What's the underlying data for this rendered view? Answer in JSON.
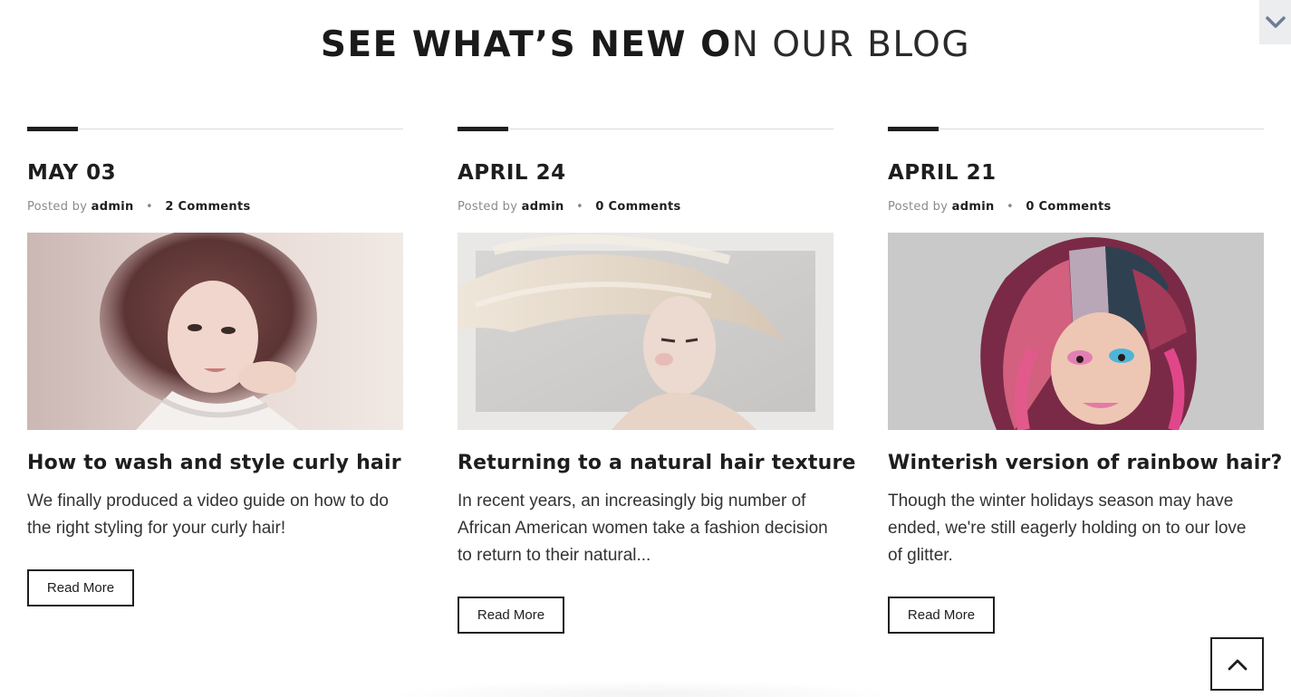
{
  "header": {
    "title_bold": "SEE WHAT’S NEW O",
    "title_light": "N OUR BLOG"
  },
  "posts": [
    {
      "date": "MAY 03",
      "posted_by_label": "Posted by",
      "author": "admin",
      "comments": "2 Comments",
      "title": "How to wash and style curly hair",
      "excerpt": "We finally produced a video guide on how to do the right styling for your curly hair!",
      "read_more": "Read More",
      "image_icon": "portrait-curly-hair-image"
    },
    {
      "date": "APRIL 24",
      "posted_by_label": "Posted by",
      "author": "admin",
      "comments": "0 Comments",
      "title": "Returning to a natural hair texture",
      "excerpt": "In recent years, an increasingly big number of African American women take a fashion decision to return to their natural...",
      "read_more": "Read More",
      "image_icon": "portrait-blonde-hair-image"
    },
    {
      "date": "APRIL 21",
      "posted_by_label": "Posted by",
      "author": "admin",
      "comments": "0 Comments",
      "title": "Winterish version of rainbow hair?",
      "excerpt": "Though the winter holidays season may have ended, we're still eagerly holding on to our love of glitter.",
      "read_more": "Read More",
      "image_icon": "portrait-rainbow-hair-image"
    }
  ],
  "controls": {
    "corner_toggle_icon": "chevron-down-icon",
    "back_to_top_icon": "chevron-up-icon"
  },
  "colors": {
    "text": "#1e1e1e",
    "meta": "#8a8a8a",
    "toggle_bg": "#ecedef"
  }
}
